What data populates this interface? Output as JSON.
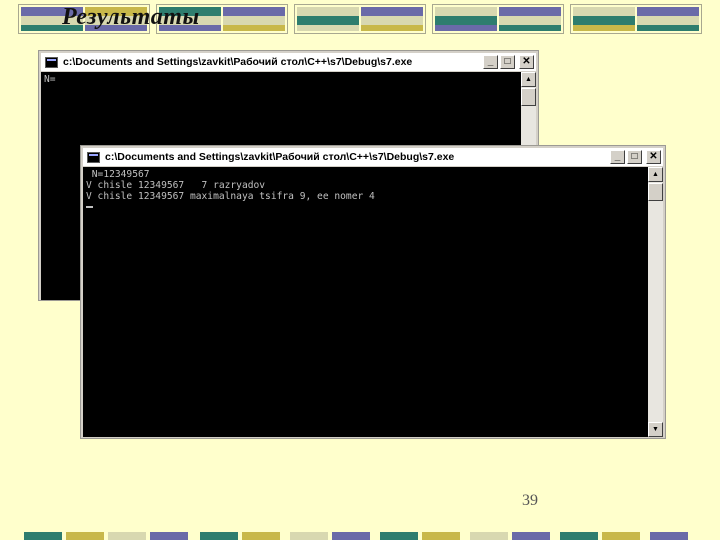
{
  "slide": {
    "title": "Результаты",
    "page_number": "39"
  },
  "colors": {
    "background": "#ffffcc",
    "band_teal": "#2e7d6e",
    "band_purple": "#6a6aa8",
    "band_olive": "#c8b84a",
    "band_light": "#d8d8b0"
  },
  "window_back": {
    "title": "c:\\Documents and Settings\\zavkit\\Рабочий стол\\C++\\s7\\Debug\\s7.exe",
    "minimize_label": "_",
    "maximize_label": "□",
    "close_label": "✕",
    "output": "N="
  },
  "window_front": {
    "title": "c:\\Documents and Settings\\zavkit\\Рабочий стол\\C++\\s7\\Debug\\s7.exe",
    "minimize_label": "_",
    "maximize_label": "□",
    "close_label": "✕",
    "output_lines": [
      " N=12349567",
      "V chisle 12349567   7 razryadov",
      "V chisle 12349567 maximalnaya tsifra 9, ee nomer 4"
    ]
  }
}
